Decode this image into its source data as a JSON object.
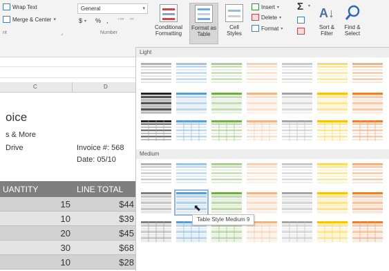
{
  "ribbon": {
    "wrap_text": "Wrap Text",
    "merge_center": "Merge & Center",
    "number_format": "General",
    "currency": "$",
    "percent": "%",
    "comma": ",",
    "alignment_label": "nt",
    "number_label": "Number",
    "conditional_formatting": [
      "Conditional",
      "Formatting"
    ],
    "format_as_table": [
      "Format as",
      "Table"
    ],
    "cell_styles": [
      "Cell",
      "Styles"
    ],
    "insert": "Insert",
    "delete": "Delete",
    "format": "Format",
    "sort_filter": [
      "Sort &",
      "Filter"
    ],
    "find_select": [
      "Find &",
      "Select"
    ]
  },
  "sheet": {
    "col_c": "C",
    "col_d": "D",
    "title": "oice",
    "company_line": "s & More",
    "address_line": "Drive",
    "invoice_label": "Invoice #: 568",
    "date_label": "Date:  05/10",
    "headers": [
      "UANTITY",
      "LINE TOTAL"
    ],
    "rows": [
      {
        "qty": "15",
        "total": "$44"
      },
      {
        "qty": "10",
        "total": "$39"
      },
      {
        "qty": "20",
        "total": "$45"
      },
      {
        "qty": "30",
        "total": "$68"
      },
      {
        "qty": "10",
        "total": "$28"
      }
    ]
  },
  "gallery": {
    "light_label": "Light",
    "medium_label": "Medium",
    "tooltip": "Table Style Medium 9",
    "colors": [
      "#7f7f7f",
      "#5b9bd5",
      "#70ad47",
      "#f4b183",
      "#a5a5a5",
      "#ffc000",
      "#ed7d31"
    ]
  }
}
